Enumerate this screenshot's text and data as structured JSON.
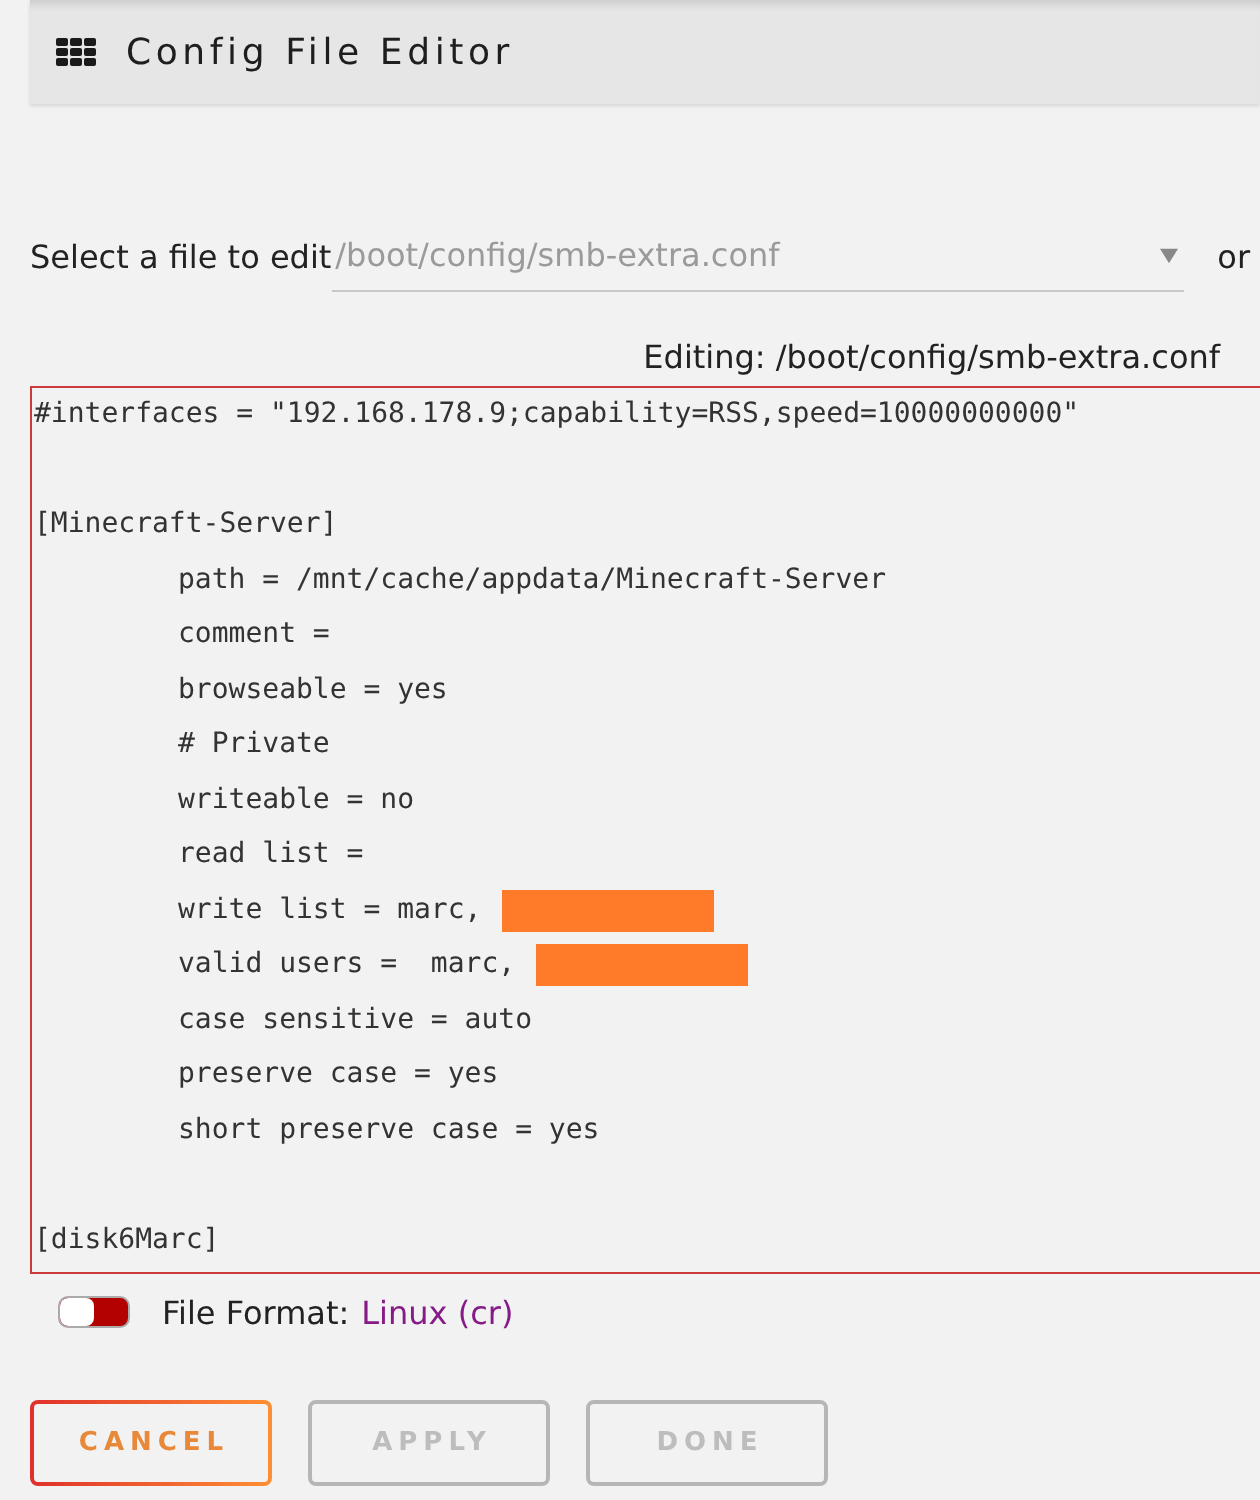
{
  "header": {
    "title": "Config File Editor"
  },
  "file_select": {
    "label": "Select a file to edit",
    "value": "/boot/config/smb-extra.conf",
    "trailing_text": "or"
  },
  "editor": {
    "caption": "Editing: /boot/config/smb-extra.conf",
    "lines": [
      {
        "kind": "code",
        "text": "#interfaces = \"192.168.178.9;capability=RSS,speed=10000000000\"",
        "redacted": false
      },
      {
        "kind": "blank"
      },
      {
        "kind": "code",
        "text": "[Minecraft-Server]",
        "redacted": false,
        "children": [
          {
            "kind": "code",
            "text": "path = /mnt/cache/appdata/Minecraft-Server",
            "redacted": false
          },
          {
            "kind": "code",
            "text": "comment =",
            "redacted": false
          },
          {
            "kind": "code",
            "text": "browseable = yes",
            "redacted": false
          },
          {
            "kind": "code",
            "text": "# Private",
            "redacted": false
          },
          {
            "kind": "code",
            "text": "writeable = no",
            "redacted": false
          },
          {
            "kind": "code",
            "text": "read list =",
            "redacted": false
          },
          {
            "kind": "code",
            "text": "write list = marc,",
            "redacted": true
          },
          {
            "kind": "code",
            "text": "valid users =  marc,",
            "redacted": true
          },
          {
            "kind": "code",
            "text": "case sensitive = auto",
            "redacted": false
          },
          {
            "kind": "code",
            "text": "preserve case = yes",
            "redacted": false
          },
          {
            "kind": "code",
            "text": "short preserve case = yes",
            "redacted": false
          }
        ]
      },
      {
        "kind": "blank"
      },
      {
        "kind": "code",
        "text": "[disk6Marc]",
        "redacted": false
      }
    ]
  },
  "file_format": {
    "on": false,
    "label": "File Format:",
    "value": "Linux (cr)"
  },
  "buttons": [
    {
      "label": "CANCEL",
      "disabled": false
    },
    {
      "label": "APPLY",
      "disabled": true
    },
    {
      "label": "DONE",
      "disabled": true
    }
  ]
}
